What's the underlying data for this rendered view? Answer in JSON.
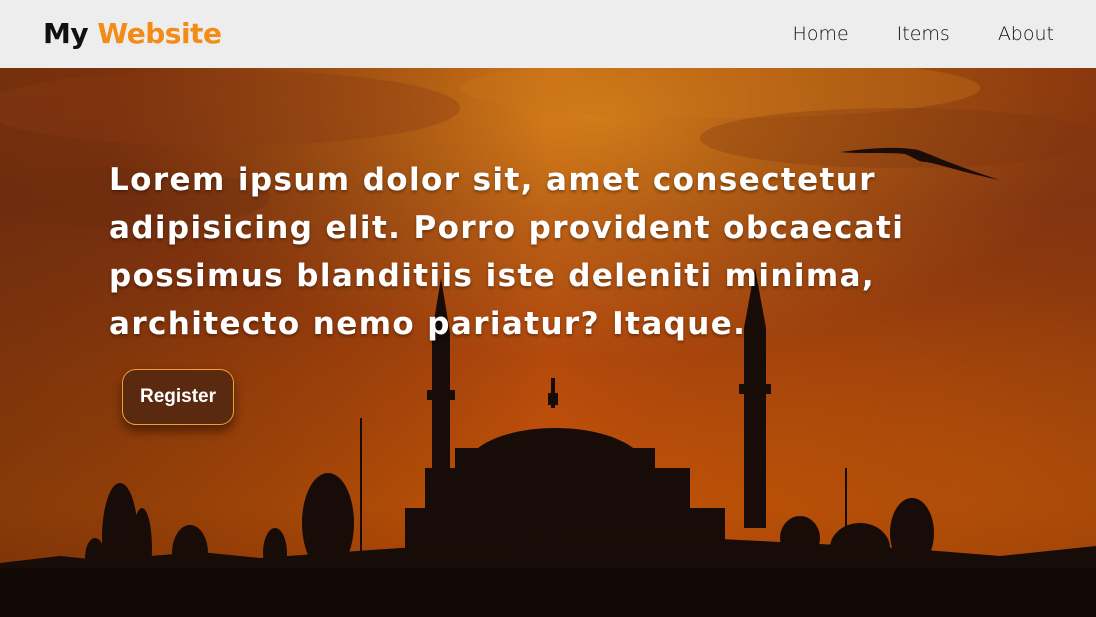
{
  "header": {
    "logo": {
      "part1": "My ",
      "part2": "Website"
    },
    "nav": [
      {
        "label": "Home"
      },
      {
        "label": "Items"
      },
      {
        "label": "About"
      }
    ]
  },
  "hero": {
    "heading": "Lorem ipsum dolor sit, amet consectetur adipisicing elit. Porro provident obcaecati possimus blanditiis iste deleniti minima, architecto nemo pariatur? Itaque.",
    "button_label": "Register"
  },
  "colors": {
    "nav_background": "#ededed",
    "logo_accent": "#f28c16",
    "button_border": "#f2a02a"
  }
}
